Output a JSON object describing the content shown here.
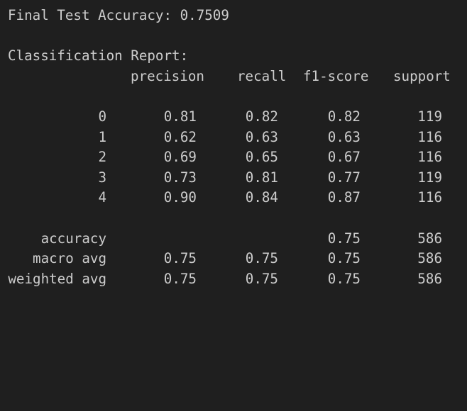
{
  "output": {
    "accuracy_line": "Final Test Accuracy: 0.7509",
    "report_title": "Classification Report:",
    "headers": {
      "precision": "precision",
      "recall": "recall",
      "f1": "f1-score",
      "support": "support"
    },
    "class_rows": [
      {
        "label": "0",
        "precision": "0.81",
        "recall": "0.82",
        "f1": "0.82",
        "support": "119"
      },
      {
        "label": "1",
        "precision": "0.62",
        "recall": "0.63",
        "f1": "0.63",
        "support": "116"
      },
      {
        "label": "2",
        "precision": "0.69",
        "recall": "0.65",
        "f1": "0.67",
        "support": "116"
      },
      {
        "label": "3",
        "precision": "0.73",
        "recall": "0.81",
        "f1": "0.77",
        "support": "119"
      },
      {
        "label": "4",
        "precision": "0.90",
        "recall": "0.84",
        "f1": "0.87",
        "support": "116"
      }
    ],
    "summary_rows": [
      {
        "label": "accuracy",
        "precision": "",
        "recall": "",
        "f1": "0.75",
        "support": "586"
      },
      {
        "label": "macro avg",
        "precision": "0.75",
        "recall": "0.75",
        "f1": "0.75",
        "support": "586"
      },
      {
        "label": "weighted avg",
        "precision": "0.75",
        "recall": "0.75",
        "f1": "0.75",
        "support": "586"
      }
    ]
  }
}
